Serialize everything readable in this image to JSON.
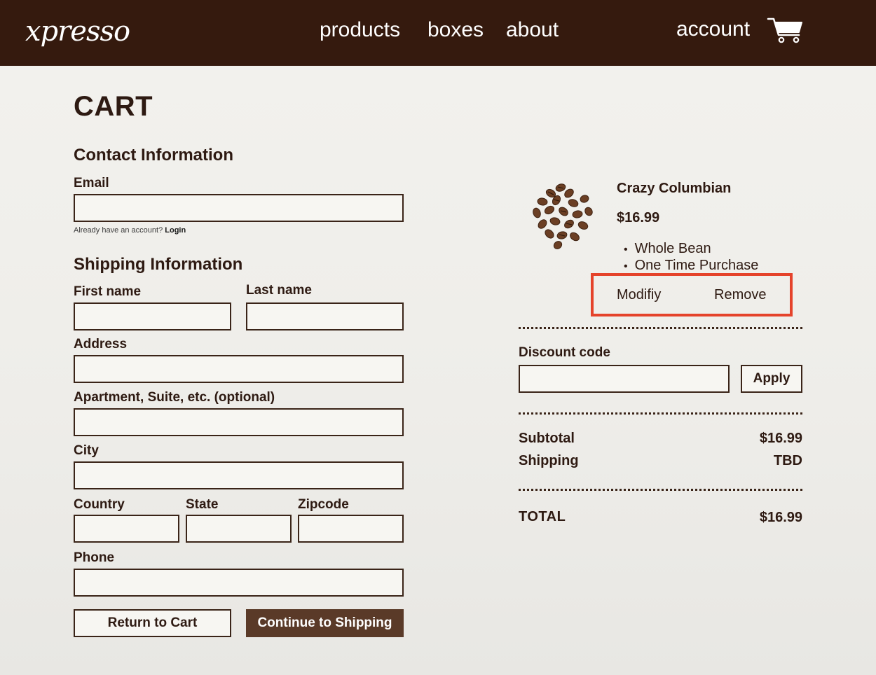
{
  "header": {
    "logo": "xpresso",
    "nav": [
      "products",
      "boxes",
      "about"
    ],
    "account": "account",
    "cart_icon": "shopping-cart-icon"
  },
  "page": {
    "title": "CART"
  },
  "contact": {
    "title": "Contact Information",
    "email_label": "Email",
    "email_value": "",
    "hint_text": "Already have an account?",
    "login_link": "Login"
  },
  "shipping": {
    "title": "Shipping Information",
    "first_name_label": "First name",
    "last_name_label": "Last name",
    "address_label": "Address",
    "apartment_label": "Apartment, Suite, etc. (optional)",
    "city_label": "City",
    "country_label": "Country",
    "state_label": "State",
    "zipcode_label": "Zipcode",
    "phone_label": "Phone"
  },
  "actions": {
    "return": "Return to Cart",
    "continue": "Continue to Shipping"
  },
  "cart_item": {
    "name": "Crazy Columbian",
    "price": "$16.99",
    "options": [
      "Whole Bean",
      "One Time Purchase"
    ],
    "modify": "Modifiy",
    "remove": "Remove",
    "highlight_color": "#e5432b"
  },
  "discount": {
    "label": "Discount code",
    "value": "",
    "apply": "Apply"
  },
  "summary": {
    "subtotal_label": "Subtotal",
    "subtotal_value": "$16.99",
    "shipping_label": "Shipping",
    "shipping_value": "TBD",
    "total_label": "TOTAL",
    "total_value": "$16.99"
  },
  "colors": {
    "header_bg": "#351a0e",
    "primary_button": "#5a3a28",
    "text": "#2e1a12"
  }
}
